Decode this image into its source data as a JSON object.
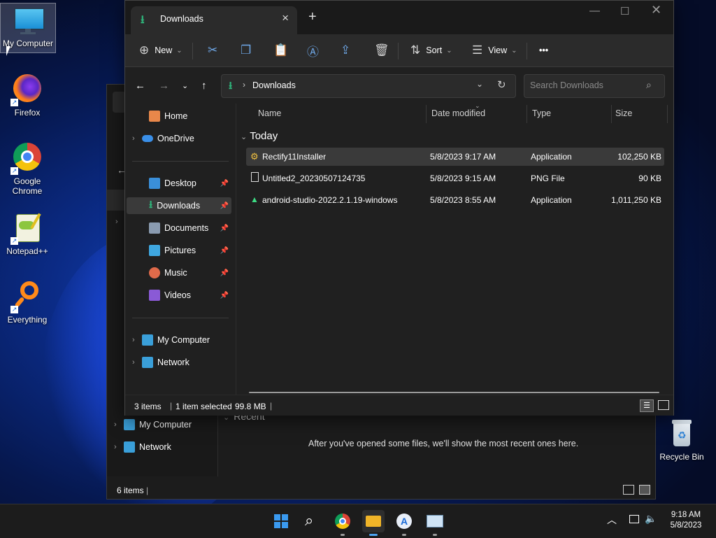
{
  "desktop": {
    "icons": [
      {
        "label": "My Computer",
        "icon": "monitor-icon"
      },
      {
        "label": "Firefox",
        "icon": "firefox-icon"
      },
      {
        "label": "Google Chrome",
        "icon": "chrome-icon"
      },
      {
        "label": "Notepad++",
        "icon": "notepad-plus-plus-icon"
      },
      {
        "label": "Everything",
        "icon": "magnifier-icon"
      },
      {
        "label": "Recycle Bin",
        "icon": "recycle-bin-icon"
      }
    ]
  },
  "back_window": {
    "nav": [
      {
        "label": "My Computer",
        "icon": "monitor-icon"
      },
      {
        "label": "Network",
        "icon": "network-icon"
      }
    ],
    "recent_header": "Recent",
    "empty_message": "After you've opened some files, we'll show the most recent ones here.",
    "status": "6 items"
  },
  "explorer": {
    "tab_title": "Downloads",
    "new_tab": "+",
    "toolbar": {
      "new_label": "New",
      "sort_label": "Sort",
      "view_label": "View",
      "more_label": "•••"
    },
    "address": {
      "path": "Downloads",
      "search_placeholder": "Search Downloads"
    },
    "sidebar": {
      "home": "Home",
      "onedrive": "OneDrive",
      "pinned": [
        {
          "label": "Desktop",
          "icon": "desktop-folder-icon",
          "color": "#3a8fd9"
        },
        {
          "label": "Downloads",
          "icon": "download-icon",
          "color": "#2fb37a"
        },
        {
          "label": "Documents",
          "icon": "documents-icon",
          "color": "#8a9bb0"
        },
        {
          "label": "Pictures",
          "icon": "pictures-icon",
          "color": "#3fa7e0"
        },
        {
          "label": "Music",
          "icon": "music-icon",
          "color": "#e06a4a"
        },
        {
          "label": "Videos",
          "icon": "videos-icon",
          "color": "#8a5ad6"
        }
      ],
      "my_computer": "My Computer",
      "network": "Network"
    },
    "columns": {
      "name": "Name",
      "date": "Date modified",
      "type": "Type",
      "size": "Size"
    },
    "group": "Today",
    "files": [
      {
        "name": "Rectify11Installer",
        "date": "5/8/2023 9:17 AM",
        "type": "Application",
        "size": "102,250 KB",
        "icon": "installer-icon",
        "selected": true
      },
      {
        "name": "Untitled2_20230507124735",
        "date": "5/8/2023 9:15 AM",
        "type": "PNG File",
        "size": "90 KB",
        "icon": "png-file-icon",
        "selected": false
      },
      {
        "name": "android-studio-2022.2.1.19-windows",
        "date": "5/8/2023 8:55 AM",
        "type": "Application",
        "size": "1,011,250 KB",
        "icon": "android-icon",
        "selected": false
      }
    ],
    "status": {
      "items": "3 items",
      "selection": "1 item selected",
      "size": "99.8 MB"
    }
  },
  "taskbar": {
    "time": "9:18 AM",
    "date": "5/8/2023"
  }
}
